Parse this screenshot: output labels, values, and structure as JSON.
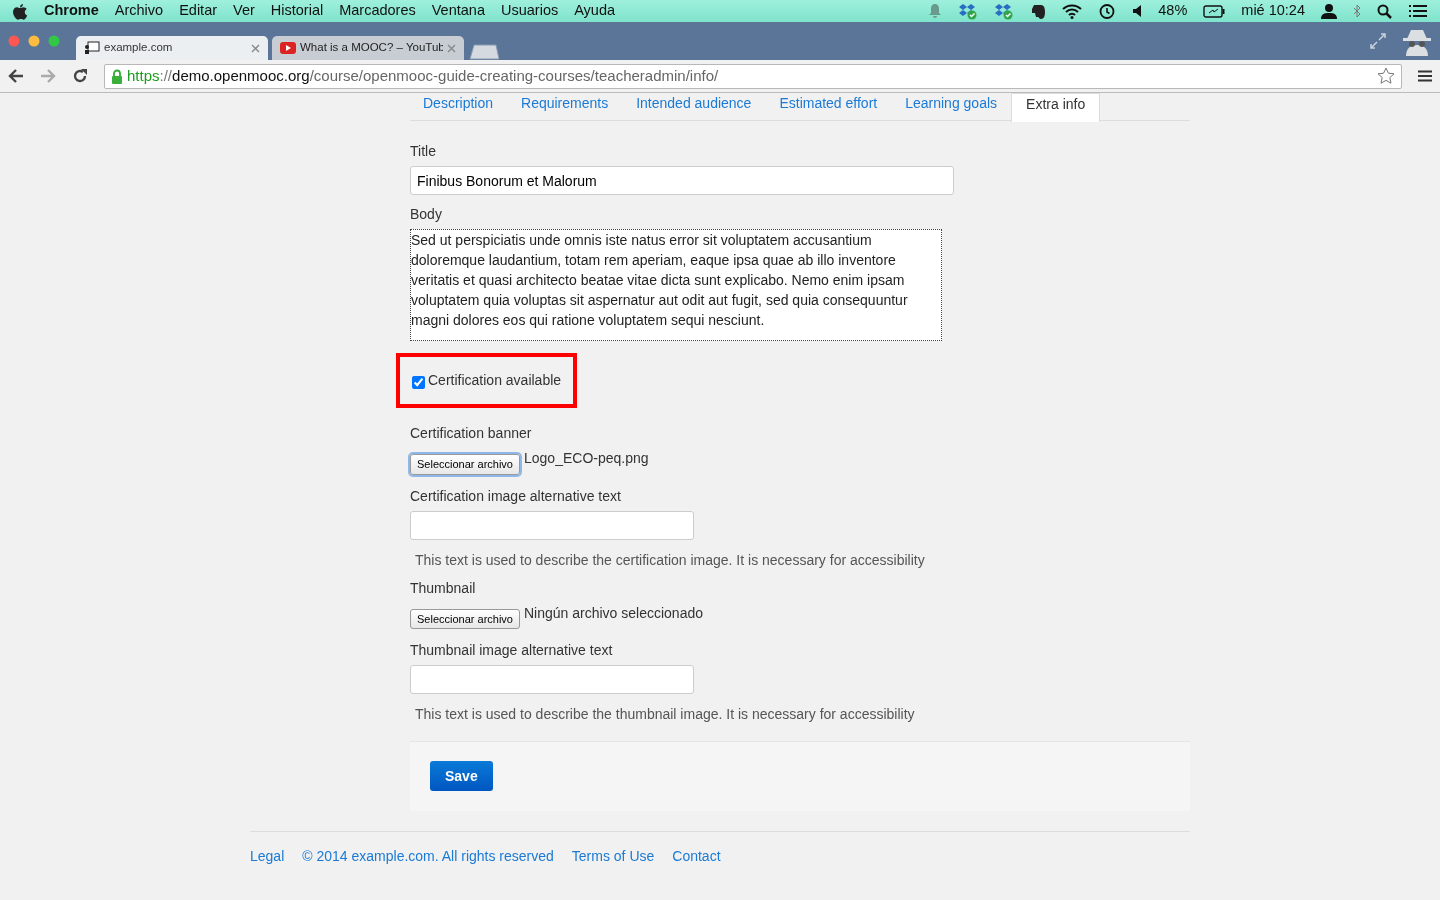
{
  "menubar": {
    "app": "Chrome",
    "menus": [
      "Archivo",
      "Editar",
      "Ver",
      "Historial",
      "Marcadores",
      "Ventana",
      "Usuarios",
      "Ayuda"
    ],
    "battery": "48%",
    "clock": "mié 10:24"
  },
  "browser_tabs": [
    {
      "title": "example.com",
      "selected": true
    },
    {
      "title": "What is a MOOC? – YouTub",
      "selected": false
    }
  ],
  "address_bar": {
    "scheme": "https",
    "separator": "://",
    "host": "demo.openmooc.org",
    "path": "/course/openmooc-guide-creating-courses/teacheradmin/info/"
  },
  "page_tabs": [
    {
      "label": "Description",
      "selected": false
    },
    {
      "label": "Requirements",
      "selected": false
    },
    {
      "label": "Intended audience",
      "selected": false
    },
    {
      "label": "Estimated effort",
      "selected": false
    },
    {
      "label": "Learning goals",
      "selected": false
    },
    {
      "label": "Extra info",
      "selected": true
    }
  ],
  "form": [
    {
      "kind": "text",
      "label": "Title",
      "value": "Finibus Bonorum et Malorum"
    },
    {
      "kind": "textarea",
      "label": "Body",
      "value": "Sed ut perspiciatis unde omnis iste natus error sit voluptatem accusantium doloremque laudantium, totam rem aperiam, eaque ipsa quae ab illo inventore veritatis et quasi architecto beatae vitae dicta sunt explicabo. Nemo enim ipsam voluptatem quia voluptas sit aspernatur aut odit aut fugit, sed quia consequuntur magni dolores eos qui ratione voluptatem sequi nesciunt."
    },
    {
      "kind": "checkbox",
      "label": "Certification available",
      "checked": true,
      "highlighted": true
    },
    {
      "kind": "file",
      "label": "Certification banner",
      "button": "Seleccionar archivo",
      "filename": "Logo_ECO-peq.png",
      "focused": true
    },
    {
      "kind": "text",
      "label": "Certification image alternative text",
      "help": "This text is used to describe the certification image. It is necessary for accessibility"
    },
    {
      "kind": "file",
      "label": "Thumbnail",
      "button": "Seleccionar archivo",
      "filename": "Ningún archivo seleccionado",
      "focused": false
    },
    {
      "kind": "text",
      "label": "Thumbnail image alternative text",
      "help": "This text is used to describe the thumbnail image. It is necessary for accessibility"
    }
  ],
  "save_button": "Save",
  "footer_links": [
    "Legal",
    "© 2014 example.com. All rights reserved",
    "Terms of Use",
    "Contact"
  ]
}
